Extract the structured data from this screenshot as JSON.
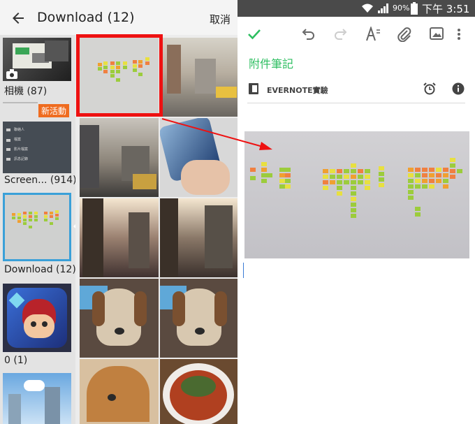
{
  "left": {
    "header": {
      "title": "Download (12)",
      "cancel_label": "取消"
    },
    "albums": [
      {
        "label": "相機 (87)",
        "badge": "新活動"
      },
      {
        "label": "Screen... (914)"
      },
      {
        "label": "Download (12)"
      },
      {
        "label": "0 (1)"
      }
    ],
    "screenshot_menu": [
      "聯絡人",
      "檔案",
      "影片檔案",
      "訊息記錄"
    ]
  },
  "right": {
    "status": {
      "battery": "90%",
      "time": "下午 3:51"
    },
    "note_title": "附件筆記",
    "notebook_name": "EVERNOTE實驗"
  },
  "colors": {
    "accent_green": "#2dbe60",
    "highlight_red": "#ee1111",
    "badge_orange": "#ef6c20",
    "selection_blue": "#3aa0d8"
  }
}
